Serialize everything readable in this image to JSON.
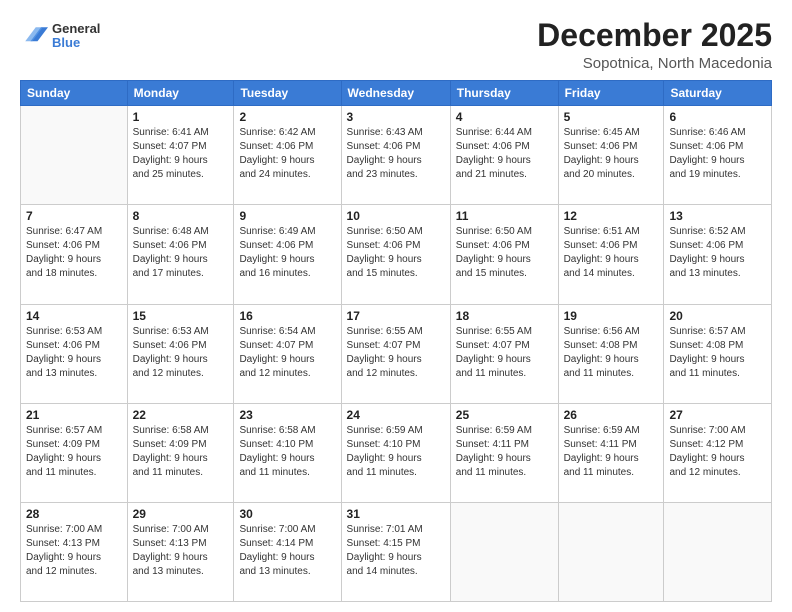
{
  "header": {
    "logo": {
      "general": "General",
      "blue": "Blue"
    },
    "month": "December 2025",
    "location": "Sopotnica, North Macedonia"
  },
  "weekdays": [
    "Sunday",
    "Monday",
    "Tuesday",
    "Wednesday",
    "Thursday",
    "Friday",
    "Saturday"
  ],
  "weeks": [
    [
      {
        "day": "",
        "info": ""
      },
      {
        "day": "1",
        "info": "Sunrise: 6:41 AM\nSunset: 4:07 PM\nDaylight: 9 hours\nand 25 minutes."
      },
      {
        "day": "2",
        "info": "Sunrise: 6:42 AM\nSunset: 4:06 PM\nDaylight: 9 hours\nand 24 minutes."
      },
      {
        "day": "3",
        "info": "Sunrise: 6:43 AM\nSunset: 4:06 PM\nDaylight: 9 hours\nand 23 minutes."
      },
      {
        "day": "4",
        "info": "Sunrise: 6:44 AM\nSunset: 4:06 PM\nDaylight: 9 hours\nand 21 minutes."
      },
      {
        "day": "5",
        "info": "Sunrise: 6:45 AM\nSunset: 4:06 PM\nDaylight: 9 hours\nand 20 minutes."
      },
      {
        "day": "6",
        "info": "Sunrise: 6:46 AM\nSunset: 4:06 PM\nDaylight: 9 hours\nand 19 minutes."
      }
    ],
    [
      {
        "day": "7",
        "info": "Sunrise: 6:47 AM\nSunset: 4:06 PM\nDaylight: 9 hours\nand 18 minutes."
      },
      {
        "day": "8",
        "info": "Sunrise: 6:48 AM\nSunset: 4:06 PM\nDaylight: 9 hours\nand 17 minutes."
      },
      {
        "day": "9",
        "info": "Sunrise: 6:49 AM\nSunset: 4:06 PM\nDaylight: 9 hours\nand 16 minutes."
      },
      {
        "day": "10",
        "info": "Sunrise: 6:50 AM\nSunset: 4:06 PM\nDaylight: 9 hours\nand 15 minutes."
      },
      {
        "day": "11",
        "info": "Sunrise: 6:50 AM\nSunset: 4:06 PM\nDaylight: 9 hours\nand 15 minutes."
      },
      {
        "day": "12",
        "info": "Sunrise: 6:51 AM\nSunset: 4:06 PM\nDaylight: 9 hours\nand 14 minutes."
      },
      {
        "day": "13",
        "info": "Sunrise: 6:52 AM\nSunset: 4:06 PM\nDaylight: 9 hours\nand 13 minutes."
      }
    ],
    [
      {
        "day": "14",
        "info": "Sunrise: 6:53 AM\nSunset: 4:06 PM\nDaylight: 9 hours\nand 13 minutes."
      },
      {
        "day": "15",
        "info": "Sunrise: 6:53 AM\nSunset: 4:06 PM\nDaylight: 9 hours\nand 12 minutes."
      },
      {
        "day": "16",
        "info": "Sunrise: 6:54 AM\nSunset: 4:07 PM\nDaylight: 9 hours\nand 12 minutes."
      },
      {
        "day": "17",
        "info": "Sunrise: 6:55 AM\nSunset: 4:07 PM\nDaylight: 9 hours\nand 12 minutes."
      },
      {
        "day": "18",
        "info": "Sunrise: 6:55 AM\nSunset: 4:07 PM\nDaylight: 9 hours\nand 11 minutes."
      },
      {
        "day": "19",
        "info": "Sunrise: 6:56 AM\nSunset: 4:08 PM\nDaylight: 9 hours\nand 11 minutes."
      },
      {
        "day": "20",
        "info": "Sunrise: 6:57 AM\nSunset: 4:08 PM\nDaylight: 9 hours\nand 11 minutes."
      }
    ],
    [
      {
        "day": "21",
        "info": "Sunrise: 6:57 AM\nSunset: 4:09 PM\nDaylight: 9 hours\nand 11 minutes."
      },
      {
        "day": "22",
        "info": "Sunrise: 6:58 AM\nSunset: 4:09 PM\nDaylight: 9 hours\nand 11 minutes."
      },
      {
        "day": "23",
        "info": "Sunrise: 6:58 AM\nSunset: 4:10 PM\nDaylight: 9 hours\nand 11 minutes."
      },
      {
        "day": "24",
        "info": "Sunrise: 6:59 AM\nSunset: 4:10 PM\nDaylight: 9 hours\nand 11 minutes."
      },
      {
        "day": "25",
        "info": "Sunrise: 6:59 AM\nSunset: 4:11 PM\nDaylight: 9 hours\nand 11 minutes."
      },
      {
        "day": "26",
        "info": "Sunrise: 6:59 AM\nSunset: 4:11 PM\nDaylight: 9 hours\nand 11 minutes."
      },
      {
        "day": "27",
        "info": "Sunrise: 7:00 AM\nSunset: 4:12 PM\nDaylight: 9 hours\nand 12 minutes."
      }
    ],
    [
      {
        "day": "28",
        "info": "Sunrise: 7:00 AM\nSunset: 4:13 PM\nDaylight: 9 hours\nand 12 minutes."
      },
      {
        "day": "29",
        "info": "Sunrise: 7:00 AM\nSunset: 4:13 PM\nDaylight: 9 hours\nand 13 minutes."
      },
      {
        "day": "30",
        "info": "Sunrise: 7:00 AM\nSunset: 4:14 PM\nDaylight: 9 hours\nand 13 minutes."
      },
      {
        "day": "31",
        "info": "Sunrise: 7:01 AM\nSunset: 4:15 PM\nDaylight: 9 hours\nand 14 minutes."
      },
      {
        "day": "",
        "info": ""
      },
      {
        "day": "",
        "info": ""
      },
      {
        "day": "",
        "info": ""
      }
    ]
  ]
}
